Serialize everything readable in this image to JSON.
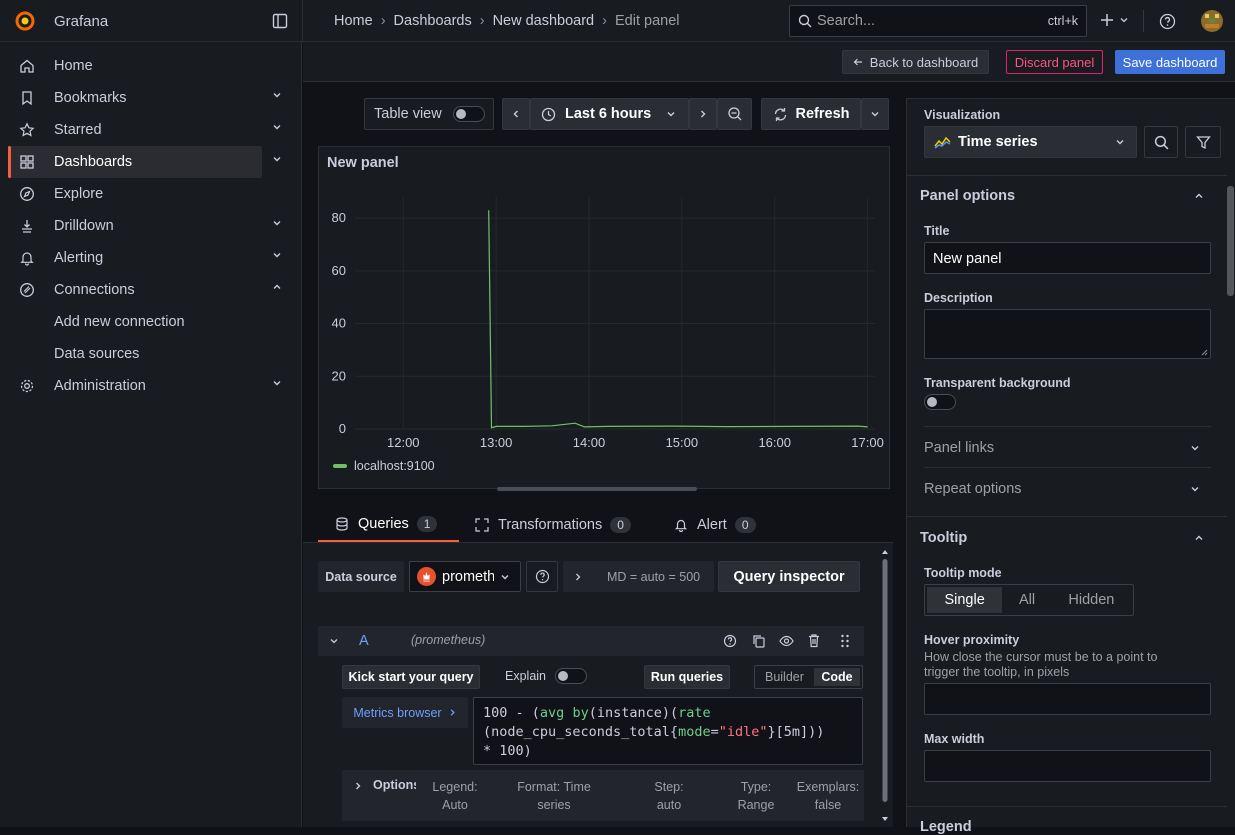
{
  "topbar": {
    "app_name": "Grafana",
    "breadcrumbs": [
      "Home",
      "Dashboards",
      "New dashboard",
      "Edit panel"
    ],
    "search_placeholder": "Search...",
    "search_shortcut": "ctrl+k"
  },
  "sidebar": {
    "items": [
      {
        "label": "Home",
        "icon": "home-icon",
        "expandable": false
      },
      {
        "label": "Bookmarks",
        "icon": "bookmark-icon",
        "expandable": true
      },
      {
        "label": "Starred",
        "icon": "star-icon",
        "expandable": true
      },
      {
        "label": "Dashboards",
        "icon": "apps-icon",
        "expandable": true,
        "active": true
      },
      {
        "label": "Explore",
        "icon": "compass-icon",
        "expandable": false
      },
      {
        "label": "Drilldown",
        "icon": "drilldown-icon",
        "expandable": true
      },
      {
        "label": "Alerting",
        "icon": "bell-icon",
        "expandable": true
      },
      {
        "label": "Connections",
        "icon": "connections-icon",
        "expandable": true,
        "expanded": true
      },
      {
        "label": "Administration",
        "icon": "cog-icon",
        "expandable": true
      }
    ],
    "connections_children": [
      "Add new connection",
      "Data sources"
    ]
  },
  "toolbar": {
    "back_label": "Back to dashboard",
    "discard_label": "Discard panel",
    "save_label": "Save dashboard"
  },
  "timebar": {
    "table_view_label": "Table view",
    "table_view_on": false,
    "time_range": "Last 6 hours",
    "refresh_label": "Refresh"
  },
  "panel": {
    "title": "New panel"
  },
  "chart_data": {
    "type": "line",
    "x_ticks": [
      "12:00",
      "13:00",
      "14:00",
      "15:00",
      "16:00",
      "17:00"
    ],
    "y_ticks": [
      0,
      20,
      40,
      60,
      80
    ],
    "ylim": [
      0,
      88
    ],
    "series": [
      {
        "name": "localhost:9100",
        "color": "#73bf69",
        "x": [
          12.92,
          12.95,
          13.0,
          13.3,
          13.6,
          13.85,
          13.95,
          14.2,
          14.9,
          15.5,
          16.2,
          16.9,
          17.0
        ],
        "y": [
          83,
          0.5,
          1,
          1,
          1.2,
          2.2,
          0.8,
          1,
          1.1,
          0.9,
          1,
          1.1,
          0.8
        ]
      }
    ],
    "legend": "bottom-left"
  },
  "tabs": [
    {
      "label": "Queries",
      "count": "1",
      "active": true
    },
    {
      "label": "Transformations",
      "count": "0"
    },
    {
      "label": "Alert",
      "count": "0"
    }
  ],
  "query": {
    "datasource_label": "Data source",
    "datasource_value": "prometheus",
    "md_text": "MD = auto = 500",
    "inspector_label": "Query inspector",
    "refid": "A",
    "ds_hint": "(prometheus)",
    "kick_start": "Kick start your query",
    "explain_label": "Explain",
    "run_label": "Run queries",
    "builder_label": "Builder",
    "code_label": "Code",
    "metrics_browser": "Metrics browser",
    "code_line1": "100 - (avg by(instance)(rate",
    "code_line2": "(node_cpu_seconds_total{mode=\"idle\"}[5m]))",
    "code_line3": "* 100)",
    "options_label": "Options",
    "options": [
      {
        "k": "Legend:",
        "v": "Auto"
      },
      {
        "k": "Format: Time",
        "v": "series"
      },
      {
        "k": "Step:",
        "v": "auto"
      },
      {
        "k": "Type:",
        "v": "Range"
      },
      {
        "k": "Exemplars:",
        "v": "false"
      }
    ]
  },
  "options_pane": {
    "viz_label": "Visualization",
    "viz_value": "Time series",
    "panel_options_header": "Panel options",
    "title_label": "Title",
    "title_value": "New panel",
    "description_label": "Description",
    "transparent_label": "Transparent background",
    "panel_links": "Panel links",
    "repeat_options": "Repeat options",
    "tooltip_header": "Tooltip",
    "tooltip_mode_label": "Tooltip mode",
    "tooltip_modes": [
      "Single",
      "All",
      "Hidden"
    ],
    "hover_label": "Hover proximity",
    "hover_desc": "How close the cursor must be to a point to trigger the tooltip, in pixels",
    "max_width_label": "Max width",
    "legend_header": "Legend"
  }
}
